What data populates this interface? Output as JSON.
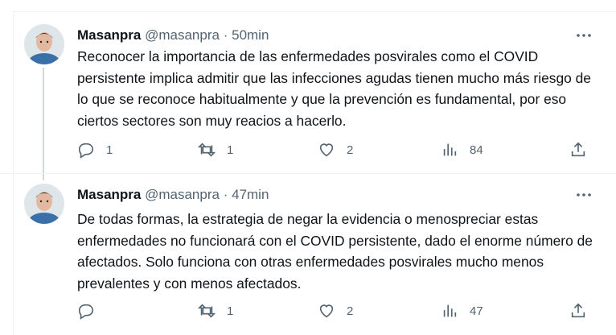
{
  "tweets": [
    {
      "author_name": "Masanpra",
      "handle": "@masanpra",
      "separator": "·",
      "time": "50min",
      "text": "Reconocer la importancia de las enfermedades posvirales como el COVID persistente implica admitir que las infecciones agudas tienen mucho más riesgo de lo que se reconoce habitualmente y que la prevención es fundamental, por eso ciertos sectores son muy reacios a hacerlo.",
      "replies": "1",
      "retweets": "1",
      "likes": "2",
      "views": "84"
    },
    {
      "author_name": "Masanpra",
      "handle": "@masanpra",
      "separator": "·",
      "time": "47min",
      "text": "De todas formas, la estrategia de negar la evidencia o menospreciar estas enfermedades no funcionará con el COVID persistente, dado el enorme número de afectados. Solo funciona con otras enfermedades posvirales mucho menos prevalentes y con menos afectados.",
      "replies": "",
      "retweets": "1",
      "likes": "2",
      "views": "47"
    }
  ],
  "icons": {
    "reply": "reply-icon",
    "retweet": "retweet-icon",
    "like": "heart-icon",
    "views": "views-icon",
    "share": "share-icon",
    "more": "more-icon"
  },
  "colors": {
    "text": "#0f1419",
    "secondary": "#536471",
    "thread_line": "#cfd9de",
    "divider": "#eff3f4"
  }
}
